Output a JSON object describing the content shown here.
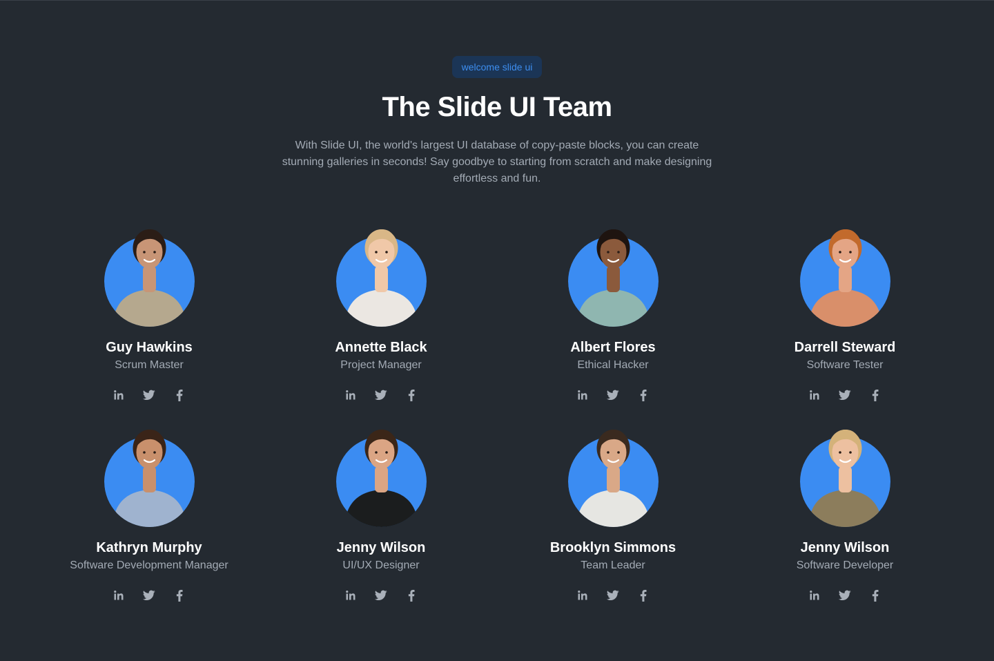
{
  "header": {
    "badge": "welcome slide ui",
    "title": "The Slide UI Team",
    "subtitle": "With Slide UI, the world's largest UI database of copy-paste blocks, you can create stunning galleries in seconds! Say goodbye to starting from scratch and make designing effortless and fun."
  },
  "colors": {
    "background": "#242a31",
    "accent": "#3b8cf2",
    "badge_bg": "#1b3556",
    "badge_text": "#3d8ef0",
    "muted_text": "#a3abb5",
    "icon": "#a9b0b9"
  },
  "social_icons": [
    "linkedin-icon",
    "twitter-icon",
    "facebook-icon"
  ],
  "team": [
    {
      "name": "Guy Hawkins",
      "role": "Scrum Master",
      "skin": "#c89576",
      "hair": "#2b1d16",
      "shirt": "#b5a88e"
    },
    {
      "name": "Annette Black",
      "role": "Project Manager",
      "skin": "#f0c8a8",
      "hair": "#d9b787",
      "shirt": "#ebe7e2"
    },
    {
      "name": "Albert Flores",
      "role": "Ethical Hacker",
      "skin": "#8b5a3c",
      "hair": "#1e1410",
      "shirt": "#8fb6b0"
    },
    {
      "name": "Darrell Steward",
      "role": "Software Tester",
      "skin": "#e4a585",
      "hair": "#c26a2c",
      "shirt": "#d98f6a"
    },
    {
      "name": "Kathryn Murphy",
      "role": "Software Development Manager",
      "skin": "#c9906c",
      "hair": "#3a2418",
      "shirt": "#9fb3cf"
    },
    {
      "name": "Jenny Wilson",
      "role": "UI/UX Designer",
      "skin": "#dba584",
      "hair": "#3b2618",
      "shirt": "#1b1d1e"
    },
    {
      "name": "Brooklyn Simmons",
      "role": "Team Leader",
      "skin": "#d9a887",
      "hair": "#3a2a1f",
      "shirt": "#e6e6e2"
    },
    {
      "name": "Jenny Wilson",
      "role": "Software Developer",
      "skin": "#edc0a0",
      "hair": "#d4b27a",
      "shirt": "#8c7d5c"
    }
  ]
}
